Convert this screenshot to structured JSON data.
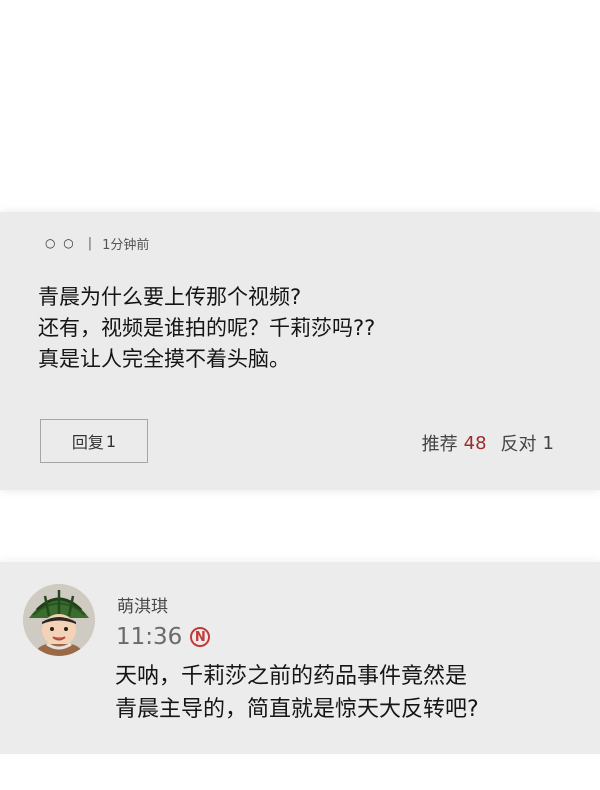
{
  "comment": {
    "username_masked": "○ ○",
    "separator": "|",
    "time": "1分钟前",
    "lines": [
      "青晨为什么要上传那个视频?",
      "还有，视频是谁拍的呢？千莉莎吗??",
      "真是让人完全摸不着头脑。"
    ],
    "reply_label": "回复",
    "reply_count": "1",
    "recommend_label": "推荐",
    "recommend_count": "48",
    "oppose_label": "反对",
    "oppose_count": "1",
    "accent_color": "#9b2b2b"
  },
  "message": {
    "sender": "萌淇琪",
    "time": "11:36",
    "badge": "N",
    "badge_color": "#c23a3a",
    "lines": [
      "天呐，千莉莎之前的药品事件竟然是",
      "青晨主导的，简直就是惊天大反转吧?"
    ],
    "avatar_icon": "avatar-boy-with-watermelon-hat"
  }
}
